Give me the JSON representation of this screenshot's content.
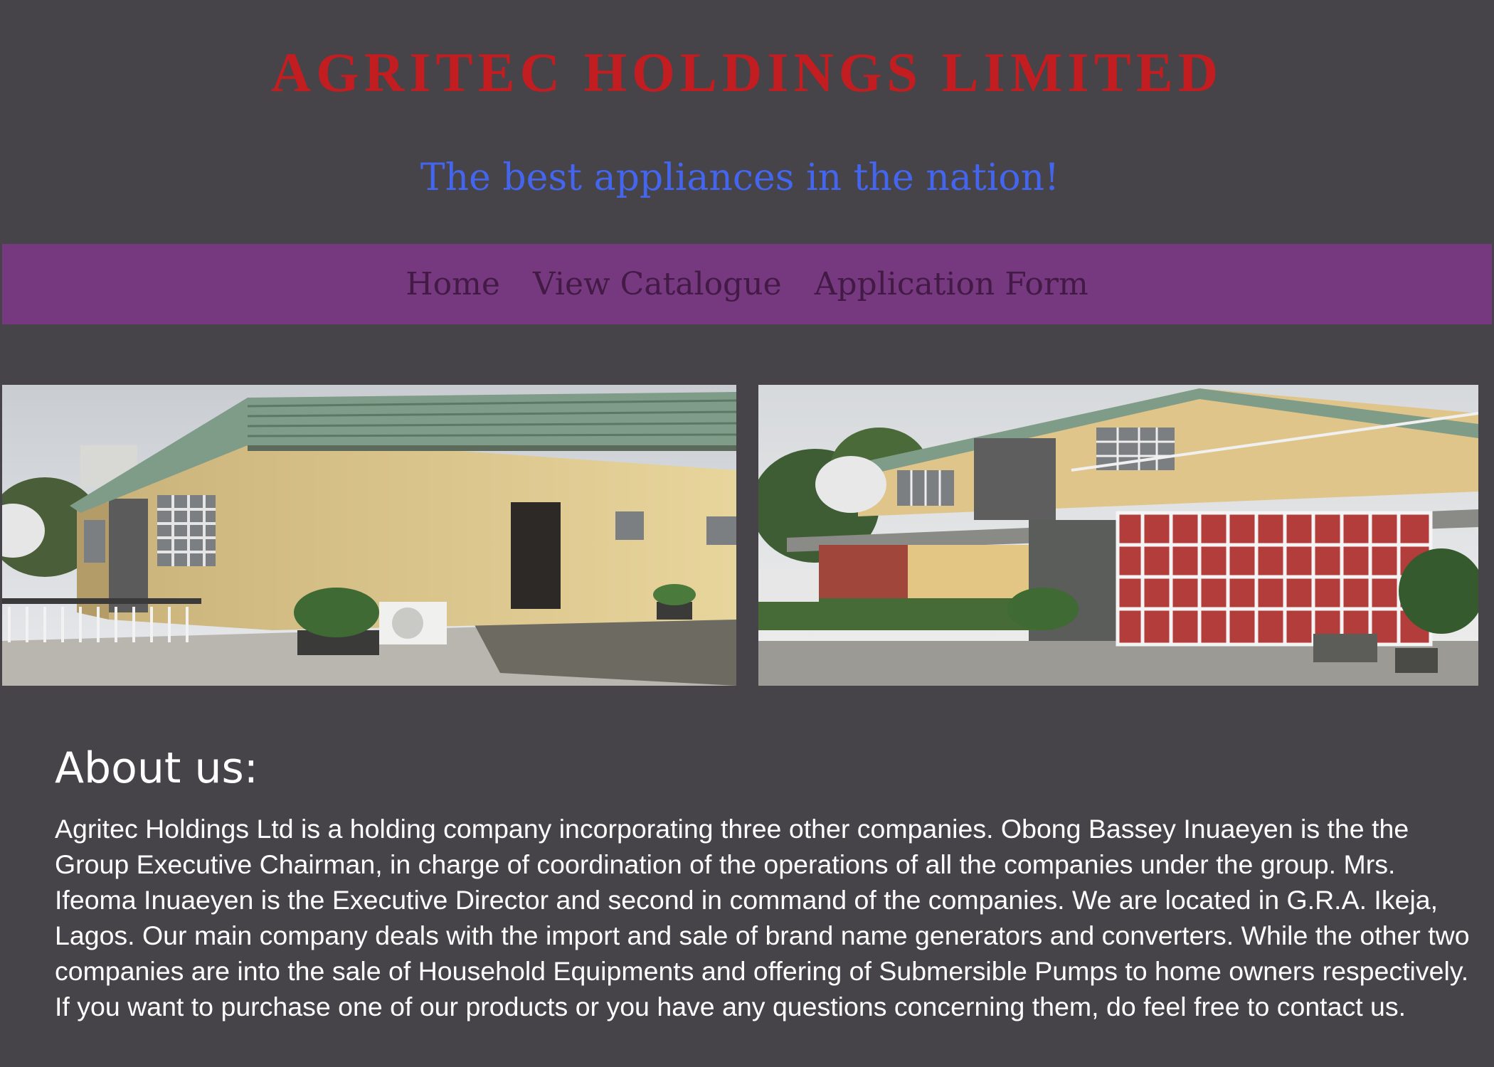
{
  "header": {
    "title": "AGRITEC HOLDINGS LIMITED",
    "tagline": "The best appliances in the nation!"
  },
  "nav": {
    "items": [
      {
        "label": "Home"
      },
      {
        "label": "View Catalogue"
      },
      {
        "label": "Application Form"
      }
    ]
  },
  "gallery": {
    "images": [
      {
        "name": "building-front-photo"
      },
      {
        "name": "building-side-photo"
      }
    ]
  },
  "about": {
    "heading": "About us:",
    "text": "Agritec Holdings Ltd is a holding company incorporating three other companies. Obong Bassey Inuaeyen is the the Group Executive Chairman, in charge of coordination of the operations of all the companies under the group. Mrs. Ifeoma Inuaeyen is the Executive Director and second in command of the companies. We are located in G.R.A. Ikeja, Lagos. Our main company deals with the import and sale of brand name generators and converters. While the other two companies are into the sale of Household Equipments and offering of Submersible Pumps to home owners respectively. If you want to purchase one of our products or you have any questions concerning them, do feel free to contact us."
  },
  "colors": {
    "background": "#464448",
    "title": "#c21d20",
    "tagline": "#4466ee",
    "nav_bar": "#76397f",
    "nav_text": "#421a45",
    "body_text": "#ffffff"
  }
}
